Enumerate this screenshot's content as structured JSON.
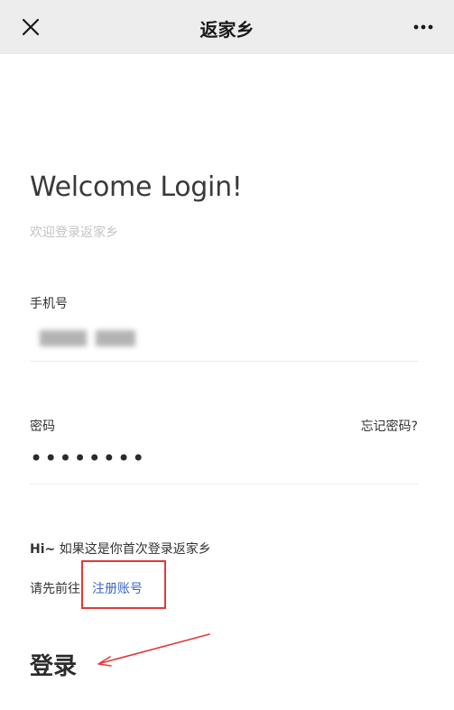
{
  "header": {
    "title": "返家乡",
    "close_icon": "close-icon",
    "more_icon": "more-dots-icon"
  },
  "welcome": {
    "title": "Welcome Login!",
    "subtitle": "欢迎登录返家乡"
  },
  "form": {
    "phone_label": "手机号",
    "phone_value_redacted": true,
    "password_label": "密码",
    "password_value": "••••••••",
    "forgot_label": "忘记密码?"
  },
  "hint": {
    "greeting": "Hi~",
    "line1": " 如果这是你首次登录返家乡",
    "line2_prefix": "请先前往",
    "register_label": "注册账号"
  },
  "login_label": "登录",
  "colors": {
    "nav_bg": "#ededed",
    "link_blue": "#3c66c4",
    "annotation_red": "#e03a3a",
    "subtitle_gray": "#c4c4c4"
  }
}
